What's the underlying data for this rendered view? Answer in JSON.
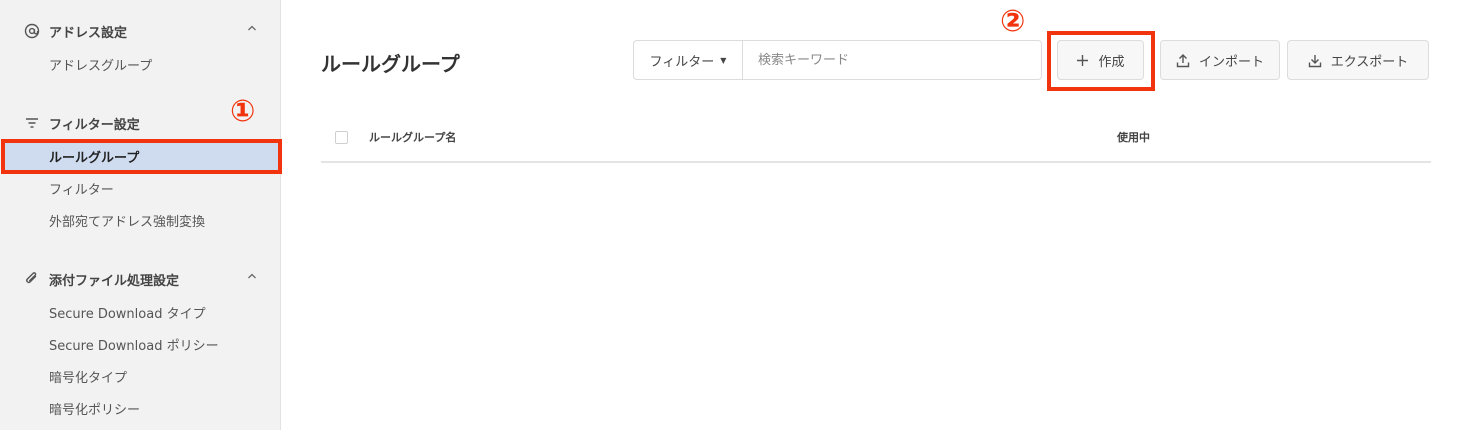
{
  "sidebar": {
    "sections": [
      {
        "title": "アドレス設定",
        "icon": "at-icon",
        "items": [
          "アドレスグループ"
        ]
      },
      {
        "title": "フィルター設定",
        "icon": "filter-lines-icon",
        "items": [
          "ルールグループ",
          "フィルター",
          "外部宛てアドレス強制変換"
        ],
        "active_item": "ルールグループ"
      },
      {
        "title": "添付ファイル処理設定",
        "icon": "paperclip-icon",
        "items": [
          "Secure Download タイプ",
          "Secure Download ポリシー",
          "暗号化タイプ",
          "暗号化ポリシー"
        ]
      }
    ]
  },
  "main": {
    "title": "ルールグループ",
    "search": {
      "filter_label": "フィルター",
      "placeholder": "検索キーワード"
    },
    "buttons": {
      "create": "作成",
      "import": "インポート",
      "export": "エクスポート"
    },
    "table": {
      "columns": [
        "ルールグループ名",
        "使用中"
      ],
      "rows": []
    }
  },
  "annotations": [
    "①",
    "②"
  ],
  "colors": {
    "annotation": "#f2340e",
    "active_bg": "#cfdcef",
    "sidebar_bg": "#f2f2f2"
  }
}
